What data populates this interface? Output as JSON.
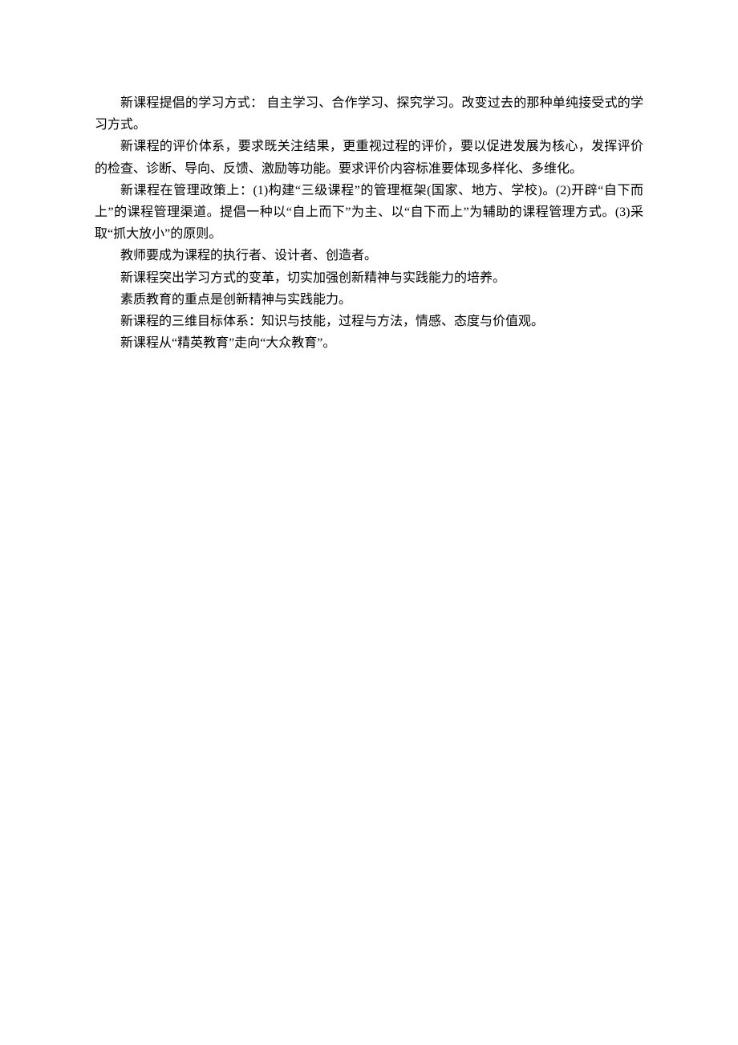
{
  "paragraphs": [
    "新课程提倡的学习方式：  自主学习、合作学习、探究学习。改变过去的那种单纯接受式的学习方式。",
    "新课程的评价体系，要求既关注结果，更重视过程的评价，要以促进发展为核心，发挥评价的检查、诊断、导向、反馈、激励等功能。要求评价内容标准要体现多样化、多维化。",
    "新课程在管理政策上：(1)构建“三级课程”的管理框架(国家、地方、学校)。(2)开辟“自下而上”的课程管理渠道。提倡一种以“自上而下”为主、以“自下而上”为辅助的课程管理方式。(3)采取“抓大放小”的原则。",
    "教师要成为课程的执行者、设计者、创造者。",
    "新课程突出学习方式的变革，切实加强创新精神与实践能力的培养。",
    "素质教育的重点是创新精神与实践能力。",
    "新课程的三维目标体系：知识与技能，过程与方法，情感、态度与价值观。",
    "新课程从“精英教育”走向“大众教育”。"
  ]
}
